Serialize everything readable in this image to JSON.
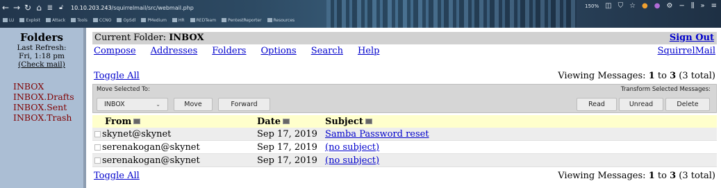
{
  "browser": {
    "url_prefix": "10.10.203.243",
    "url_path": "/squirrelmail/src/webmail.php",
    "zoom": "150%",
    "bookmarks": [
      "LU",
      "Exploit",
      "Attack",
      "Tools",
      "CCNO",
      "OpSdl",
      "PMedium",
      "HR",
      "REDTeam",
      "PentestReporter",
      "Resources"
    ]
  },
  "sidebar": {
    "title": "Folders",
    "last_refresh_label": "Last Refresh:",
    "refresh_time": "Fri, 1:18 pm",
    "check_mail": "(Check mail)",
    "folders": [
      "INBOX",
      "INBOX.Drafts",
      "INBOX.Sent",
      "INBOX.Trash"
    ]
  },
  "header": {
    "current_folder_label": "Current Folder:",
    "current_folder": "INBOX",
    "sign_out": "Sign Out",
    "brand_link": "SquirrelMail"
  },
  "menu": [
    "Compose",
    "Addresses",
    "Folders",
    "Options",
    "Search",
    "Help"
  ],
  "listing": {
    "toggle_all": "Toggle All",
    "viewing_prefix": "Viewing Messages:",
    "from_num": "1",
    "to_word": "to",
    "to_num": "3",
    "total": "(3 total)"
  },
  "toolbox": {
    "move_label": "Move Selected To:",
    "move_target": "INBOX",
    "move_button": "Move",
    "forward_button": "Forward",
    "transform_label": "Transform Selected Messages:",
    "read_button": "Read",
    "unread_button": "Unread",
    "delete_button": "Delete"
  },
  "table": {
    "headers": [
      "From",
      "Date",
      "Subject"
    ],
    "rows": [
      {
        "from": "skynet@skynet",
        "date": "Sep 17, 2019",
        "subject": "Samba Password reset"
      },
      {
        "from": "serenakogan@skynet",
        "date": "Sep 17, 2019",
        "subject": "(no subject)"
      },
      {
        "from": "serenakogan@skynet",
        "date": "Sep 17, 2019",
        "subject": "(no subject)"
      }
    ]
  },
  "colors": {
    "link": "#0000cc",
    "folder_link": "#800000",
    "sidebar_bg": "#abbed4",
    "header_row_bg": "#ffffcc",
    "title_bar_bg": "#d1d1d1"
  }
}
